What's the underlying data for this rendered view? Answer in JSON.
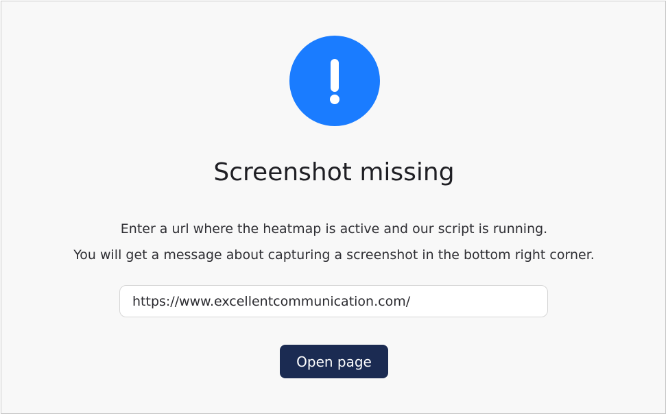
{
  "colors": {
    "alert_circle": "#1a7cff",
    "button_bg": "#1b2b52",
    "panel_bg": "#f8f8f8"
  },
  "icon": "exclamation-icon",
  "empty_state": {
    "title": "Screenshot missing",
    "line1": "Enter a url where the heatmap is active and our script is running.",
    "line2": "You will get a message about capturing a screenshot in the bottom right corner.",
    "url_value": "https://www.excellentcommunication.com/",
    "open_button_label": "Open page"
  }
}
